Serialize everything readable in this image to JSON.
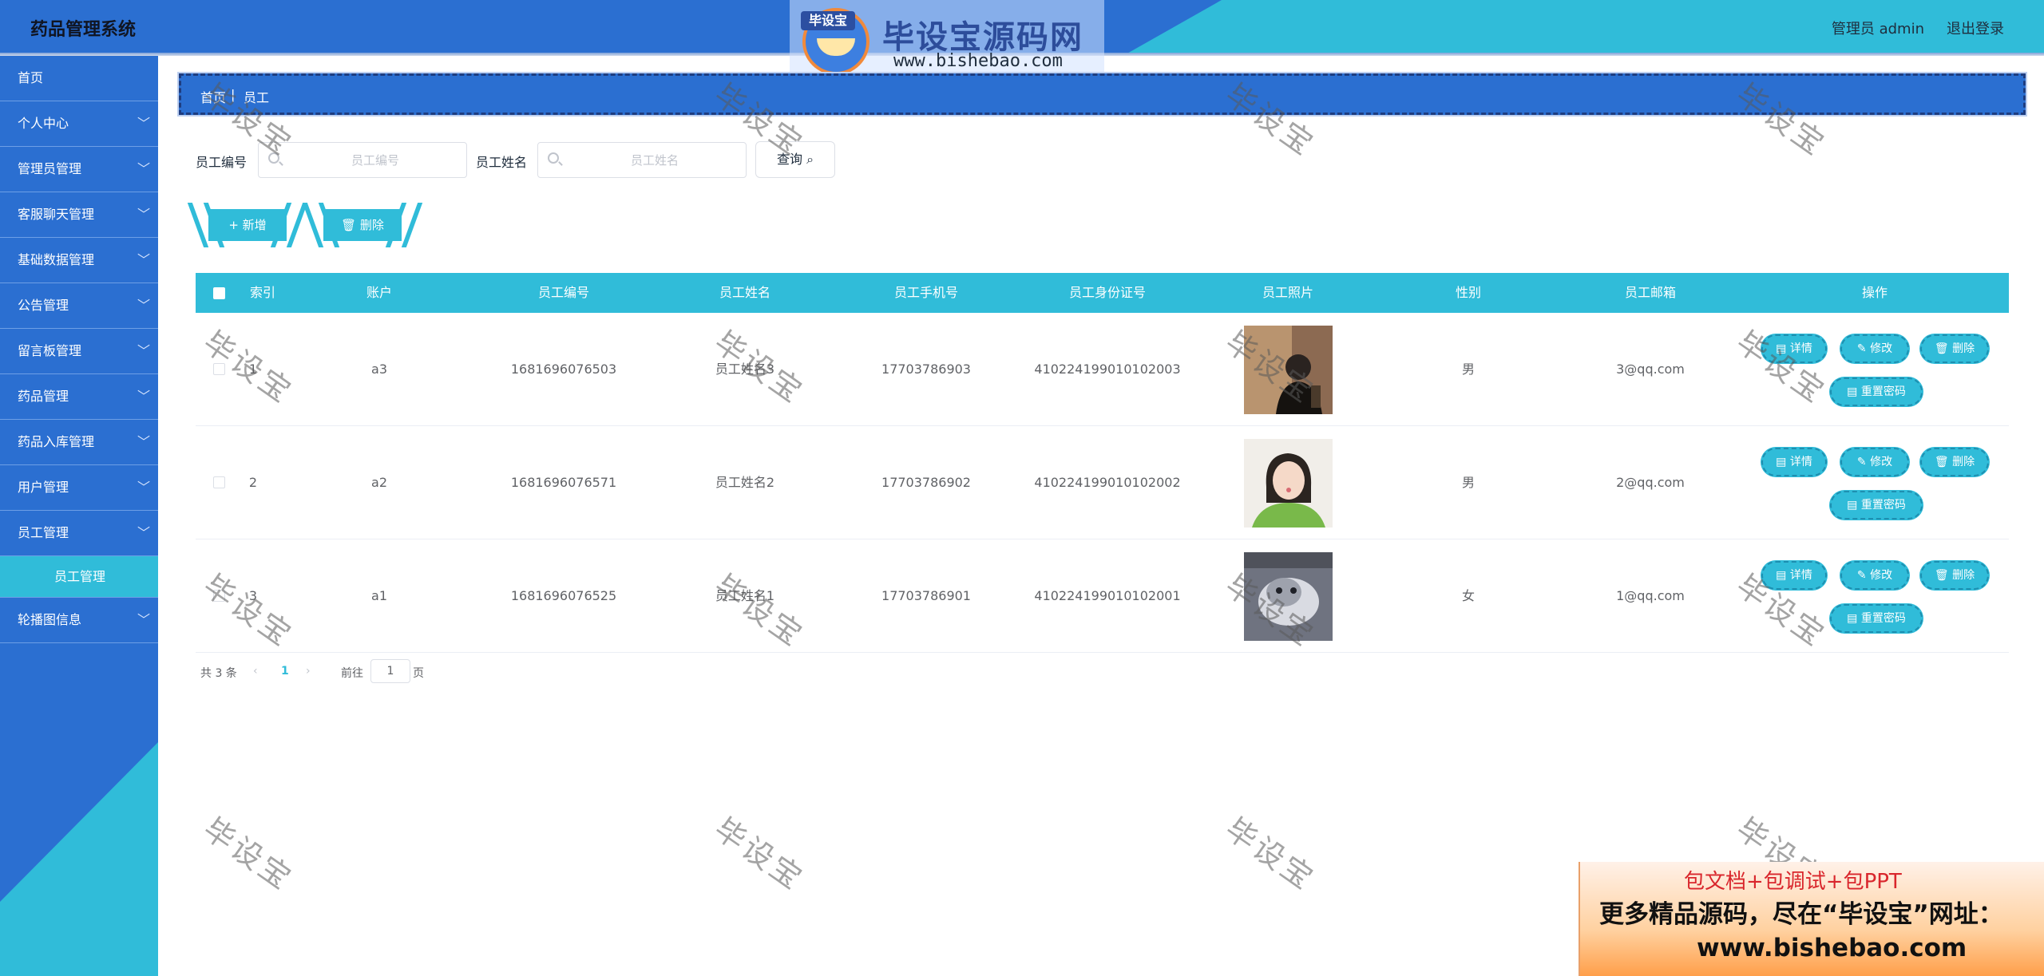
{
  "header": {
    "brand": "药品管理系统",
    "user": "管理员 admin",
    "logout": "退出登录"
  },
  "banner": {
    "tag": "毕设宝",
    "title": "毕设宝源码网",
    "url": "www.bishebao.com"
  },
  "sidebar": {
    "items": [
      {
        "label": "首页",
        "chevron": false
      },
      {
        "label": "个人中心",
        "chevron": true
      },
      {
        "label": "管理员管理",
        "chevron": true
      },
      {
        "label": "客服聊天管理",
        "chevron": true
      },
      {
        "label": "基础数据管理",
        "chevron": true
      },
      {
        "label": "公告管理",
        "chevron": true
      },
      {
        "label": "留言板管理",
        "chevron": true
      },
      {
        "label": "药品管理",
        "chevron": true
      },
      {
        "label": "药品入库管理",
        "chevron": true
      },
      {
        "label": "用户管理",
        "chevron": true
      },
      {
        "label": "员工管理",
        "chevron": true
      }
    ],
    "sub_item": "员工管理",
    "last_item": "轮播图信息",
    "chevron_icon": "chevron-down-icon"
  },
  "breadcrumb": {
    "home": "首页",
    "current": "员工"
  },
  "search": {
    "code_label": "员工编号",
    "code_placeholder": "员工编号",
    "name_label": "员工姓名",
    "name_placeholder": "员工姓名",
    "query_label": "查询"
  },
  "actions": {
    "add_label": "+ 新增",
    "delete_label": "删除"
  },
  "table": {
    "columns": [
      "索引",
      "账户",
      "员工编号",
      "员工姓名",
      "员工手机号",
      "员工身份证号",
      "员工照片",
      "性别",
      "员工邮箱",
      "操作"
    ],
    "rows": [
      {
        "index": "1",
        "account": "a3",
        "code": "1681696076503",
        "name": "员工姓名3",
        "phone": "17703786903",
        "idcard": "410224199010102003",
        "gender": "男",
        "email": "3@qq.com"
      },
      {
        "index": "2",
        "account": "a2",
        "code": "1681696076571",
        "name": "员工姓名2",
        "phone": "17703786902",
        "idcard": "410224199010102002",
        "gender": "男",
        "email": "2@qq.com"
      },
      {
        "index": "3",
        "account": "a1",
        "code": "1681696076525",
        "name": "员工姓名1",
        "phone": "17703786901",
        "idcard": "410224199010102001",
        "gender": "女",
        "email": "1@qq.com"
      }
    ],
    "ops": {
      "detail": "详情",
      "edit": "修改",
      "delete": "删除",
      "reset": "重置密码"
    }
  },
  "pager": {
    "total": "共 3 条",
    "page": "1",
    "goto": "前往",
    "unit": "页",
    "input": "1"
  },
  "watermark": "毕设宝",
  "promo": {
    "line1": "包文档+包调试+包PPT",
    "line2": "更多精品源码，尽在“毕设宝”网址：",
    "line3": "www.bishebao.com"
  },
  "colors": {
    "primary_blue": "#2b6fd1",
    "accent_cyan": "#30bcd9"
  }
}
